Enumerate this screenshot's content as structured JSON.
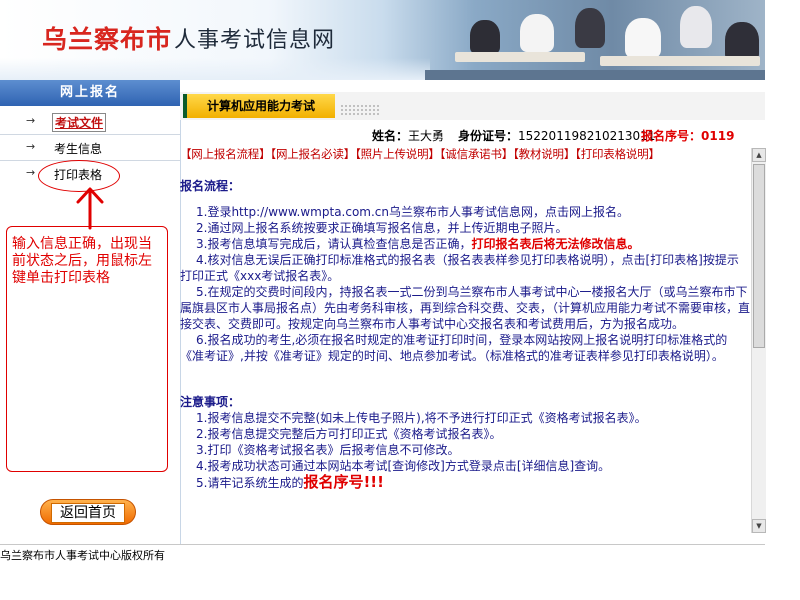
{
  "banner": {
    "city": "乌兰察布市",
    "title_rest": "人事考试信息网"
  },
  "sidebar": {
    "header": "网上报名",
    "items": [
      {
        "label": "考试文件"
      },
      {
        "label": "考生信息"
      },
      {
        "label": "打印表格"
      }
    ],
    "hint": "输入信息正确，出现当前状态之后，用鼠标左键单击打印表格",
    "home_button": "返回首页"
  },
  "main": {
    "tab_label": "计算机应用能力考试",
    "info": {
      "name_label": "姓名：",
      "name_value": "王大勇",
      "id_label": "身份证号：",
      "id_value": "152201198210213011",
      "serial_label": "报名序号：",
      "serial_value": "0119"
    },
    "links": [
      "【网上报名流程】",
      "【网上报名必读】",
      "【照片上传说明】",
      "【诚信承诺书】",
      "【教材说明】",
      "【打印表格说明】"
    ],
    "process_title": "报名流程：",
    "steps": {
      "s1": "1.登录http://www.wmpta.com.cn乌兰察布市人事考试信息网，点击网上报名。",
      "s2": "2.通过网上报名系统按要求正确填写报名信息，并上传近期电子照片。",
      "s3_a": "3.报考信息填写完成后，请认真检查信息是否正确，",
      "s3_b": "打印报名表后将无法修改信息。",
      "s4": "4.核对信息无误后正确打印标准格式的报名表（报名表表样参见打印表格说明），点击[打印表格]按提示打印正式《xxx考试报名表》。",
      "s5": "5.在规定的交费时间段内，持报名表一式二份到乌兰察布市人事考试中心一楼报名大厅（或乌兰察布市下属旗县区市人事局报名点）先由考务科审核，再到综合科交费、交表，（计算机应用能力考试不需要审核，直接交表、交费即可。按规定向乌兰察布市人事考试中心交报名表和考试费用后，方为报名成功。",
      "s6": "6.报名成功的考生,必须在报名时规定的准考证打印时间，登录本网站按网上报名说明打印标准格式的《准考证》,并按《准考证》规定的时间、地点参加考试。（标准格式的准考证表样参见打印表格说明）。"
    },
    "notice_title": "注意事项：",
    "notices": {
      "n1": "1.报考信息提交不完整(如未上传电子照片),将不予进行打印正式《资格考试报名表》。",
      "n2": "2.报考信息提交完整后方可打印正式《资格考试报名表》。",
      "n3": "3.打印《资格考试报名表》后报考信息不可修改。",
      "n4": "4.报考成功状态可通过本网站本考试[查询修改]方式登录点击[详细信息]查询。",
      "n5_a": "5.请牢记系统生成的",
      "n5_b": "报名序号!!!"
    }
  },
  "footer": "乌兰察布市人事考试中心版权所有",
  "colors": {
    "accent_blue": "#2f63b2",
    "alert_red": "#e00000",
    "tab_yellow": "#f2b000"
  }
}
